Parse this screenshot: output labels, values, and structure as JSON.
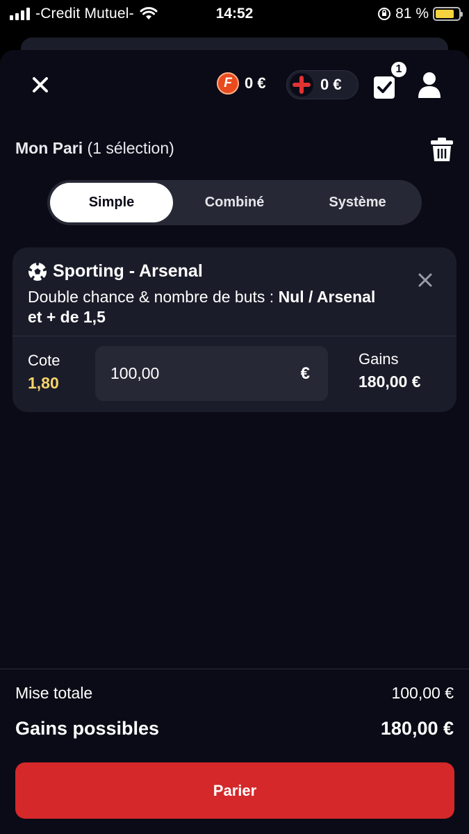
{
  "status_bar": {
    "carrier": "-Credit Mutuel-",
    "time": "14:52",
    "battery": "81 %",
    "battery_level": 0.81
  },
  "header": {
    "wallet_amount": "0 €",
    "wallet_coin_letter": "F",
    "bonus_amount": "0 €",
    "betslip_count": "1"
  },
  "bet": {
    "title": "Mon Pari",
    "selection_count": "(1 sélection)",
    "tabs": [
      {
        "label": "Simple",
        "active": true
      },
      {
        "label": "Combiné",
        "active": false
      },
      {
        "label": "Système",
        "active": false
      }
    ],
    "selection": {
      "match": "Sporting - Arsenal",
      "market_label": "Double chance & nombre de buts : ",
      "market_pick": "Nul / Arsenal et + de 1,5",
      "cote_label": "Cote",
      "cote_value": "1,80",
      "stake_value": "100,00",
      "currency": "€",
      "gains_label": "Gains",
      "gains_value": "180,00 €"
    }
  },
  "footer": {
    "mise_label": "Mise totale",
    "mise_value": "100,00 €",
    "gains_label": "Gains possibles",
    "gains_value": "180,00 €",
    "submit_label": "Parier"
  },
  "colors": {
    "accent_red": "#d4282b",
    "cote_yellow": "#f7d46a",
    "coin_orange": "#e94b1f",
    "background": "#0a0b16"
  }
}
